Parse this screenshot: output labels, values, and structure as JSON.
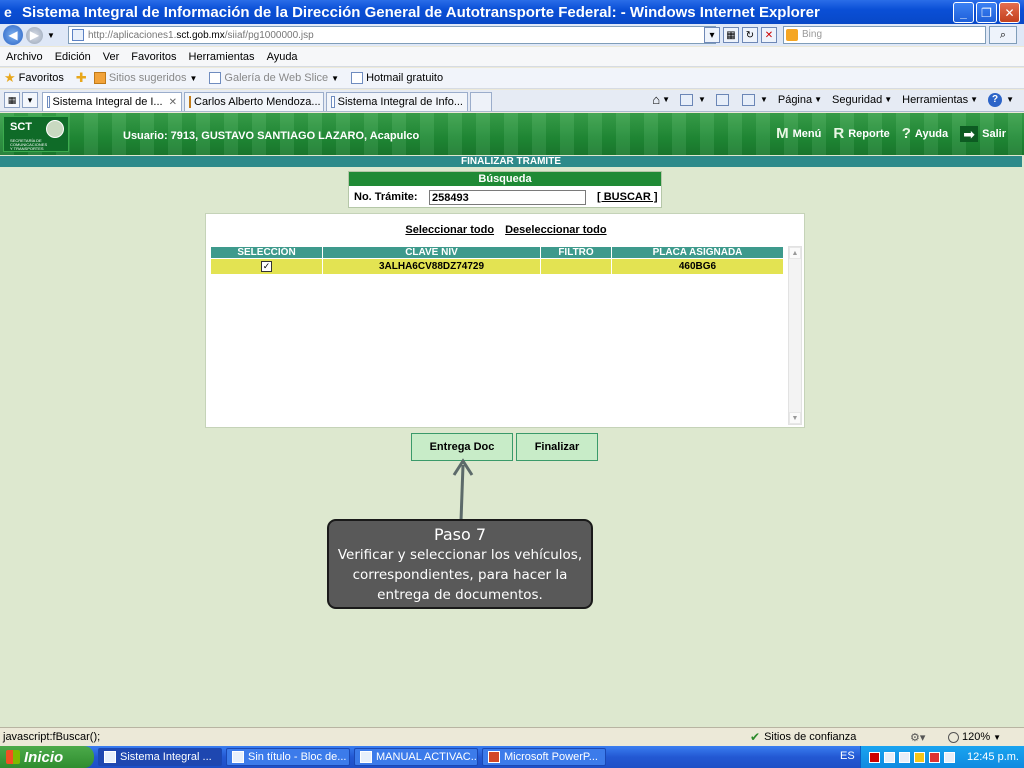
{
  "window": {
    "title": "Sistema Integral de Información de la Dirección General de Autotransporte Federal: - Windows Internet Explorer"
  },
  "address": {
    "url_prefix": "http://aplicaciones1.",
    "url_domain": "sct.gob.mx",
    "url_path": "/siiaf/pg1000000.jsp",
    "search_placeholder": "Bing"
  },
  "menu": [
    "Archivo",
    "Edición",
    "Ver",
    "Favoritos",
    "Herramientas",
    "Ayuda"
  ],
  "favorites": {
    "label": "Favoritos",
    "items": [
      "Sitios sugeridos",
      "Galería de Web Slice",
      "Hotmail gratuito"
    ]
  },
  "tabs": [
    {
      "label": "Sistema Integral de I...",
      "active": true
    },
    {
      "label": "Carlos Alberto Mendoza...",
      "active": false
    },
    {
      "label": "Sistema Integral de Info...",
      "active": false
    }
  ],
  "commands": [
    "Página",
    "Seguridad",
    "Herramientas"
  ],
  "app": {
    "logo_text": "SCT",
    "logo_sub": "SECRETARÍA DE COMUNICACIONES Y TRANSPORTES",
    "user_info": "Usuario: 7913, GUSTAVO SANTIAGO LAZARO, Acapulco",
    "nav": [
      {
        "letter": "M",
        "label": "Menú"
      },
      {
        "letter": "R",
        "label": "Reporte"
      },
      {
        "letter": "?",
        "label": "Ayuda"
      },
      {
        "letter": "➡",
        "label": "Salir"
      }
    ],
    "section_title": "FINALIZAR TRAMITE"
  },
  "search": {
    "header": "Búsqueda",
    "label": "No. Trámite:",
    "value": "258493",
    "button": "[ BUSCAR ]"
  },
  "results": {
    "select_all": "Seleccionar todo",
    "deselect_all": "Deseleccionar todo",
    "columns": [
      "SELECCIÓN",
      "CLAVE NIV",
      "FILTRO",
      "PLACA ASIGNADA"
    ],
    "rows": [
      {
        "selected": true,
        "clave_niv": "3ALHA6CV88DZ74729",
        "filtro": "",
        "placa": "460BG6"
      }
    ]
  },
  "buttons": {
    "entrega": "Entrega Doc",
    "finalizar": "Finalizar"
  },
  "callout": {
    "title": "Paso 7",
    "body": "Verificar y seleccionar los vehículos, correspondientes, para hacer la entrega de documentos."
  },
  "status": {
    "text": "javascript:fBuscar();",
    "zone": "Sitios de confianza",
    "zoom": "120%"
  },
  "taskbar": {
    "start": "Inicio",
    "tasks": [
      "Sistema Integral ...",
      "Sin título - Bloc de...",
      "MANUAL ACTIVAC...",
      "Microsoft PowerP..."
    ],
    "lang": "ES",
    "clock": "12:45 p.m."
  }
}
